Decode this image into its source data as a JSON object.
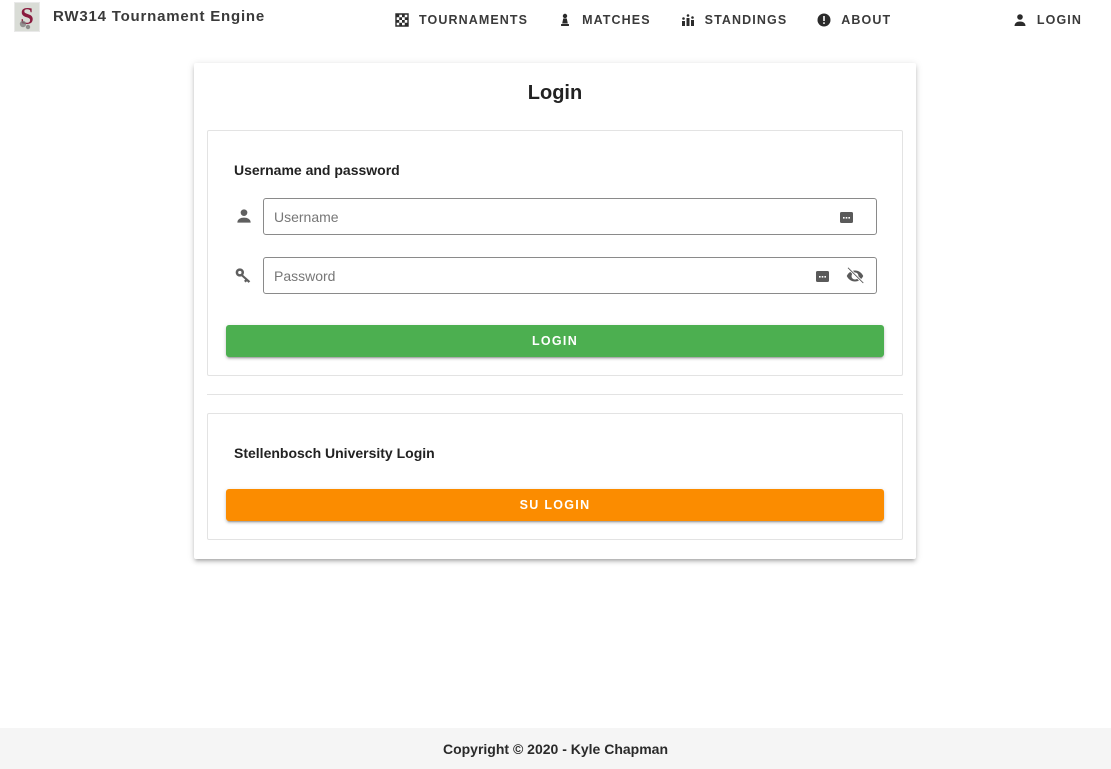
{
  "header": {
    "title": "RW314 Tournament Engine",
    "logo_icon": "su-logo-icon",
    "nav": [
      {
        "label": "Tournaments",
        "icon": "checkerboard-icon"
      },
      {
        "label": "Matches",
        "icon": "chess-pawn-icon"
      },
      {
        "label": "Standings",
        "icon": "podium-icon"
      },
      {
        "label": "About",
        "icon": "info-icon"
      }
    ],
    "login": {
      "label": "Login",
      "icon": "account-icon"
    }
  },
  "card": {
    "title": "Login",
    "credentials": {
      "heading": "Username and password",
      "username": {
        "placeholder": "Username",
        "value": ""
      },
      "password": {
        "placeholder": "Password",
        "value": ""
      },
      "submit_label": "Login",
      "submit_color": "#4caf50"
    },
    "su": {
      "heading": "Stellenbosch University Login",
      "button_label": "SU Login",
      "button_color": "#fb8c00"
    }
  },
  "footer": {
    "text": "Copyright © 2020 - Kyle Chapman"
  }
}
